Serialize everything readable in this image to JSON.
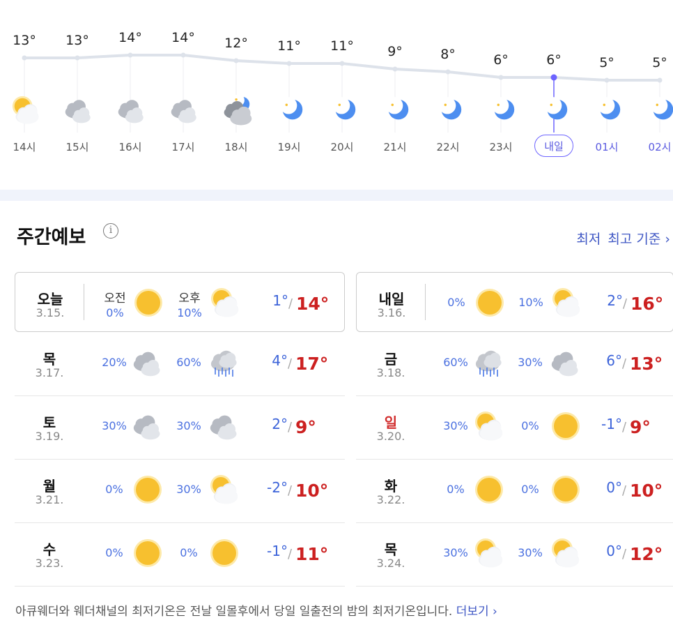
{
  "hourly": [
    {
      "temp": "13°",
      "time": "14시",
      "icon": "partly-cloudy-sun",
      "value": 13
    },
    {
      "temp": "13°",
      "time": "15시",
      "icon": "cloudy",
      "value": 13
    },
    {
      "temp": "14°",
      "time": "16시",
      "icon": "cloudy",
      "value": 14
    },
    {
      "temp": "14°",
      "time": "17시",
      "icon": "cloudy",
      "value": 14
    },
    {
      "temp": "12°",
      "time": "18시",
      "icon": "cloudy-night",
      "value": 12
    },
    {
      "temp": "11°",
      "time": "19시",
      "icon": "clear-night",
      "value": 11
    },
    {
      "temp": "11°",
      "time": "20시",
      "icon": "clear-night",
      "value": 11
    },
    {
      "temp": "9°",
      "time": "21시",
      "icon": "clear-night",
      "value": 9
    },
    {
      "temp": "8°",
      "time": "22시",
      "icon": "clear-night",
      "value": 8
    },
    {
      "temp": "6°",
      "time": "23시",
      "icon": "clear-night",
      "value": 6
    },
    {
      "temp": "6°",
      "time": "내일",
      "icon": "clear-night",
      "value": 6,
      "current": true
    },
    {
      "temp": "5°",
      "time": "01시",
      "icon": "clear-night",
      "value": 5,
      "tomorrow": true
    },
    {
      "temp": "5°",
      "time": "02시",
      "icon": "clear-night",
      "value": 5,
      "tomorrow": true
    }
  ],
  "weekly": {
    "title": "주간예보",
    "criteria_low": "최저",
    "criteria_high": "최고 기준",
    "am_label": "오전",
    "pm_label": "오후",
    "days": [
      {
        "name": "오늘",
        "date": "3.15.",
        "am_pct": "0%",
        "am_icon": "sunny",
        "pm_pct": "10%",
        "pm_icon": "partly-cloudy",
        "lo": "1°",
        "hi": "14°",
        "today": true
      },
      {
        "name": "내일",
        "date": "3.16.",
        "am_pct": "0%",
        "am_icon": "sunny",
        "pm_pct": "10%",
        "pm_icon": "partly-cloudy",
        "lo": "2°",
        "hi": "16°",
        "today": true
      },
      {
        "name": "목",
        "date": "3.17.",
        "am_pct": "20%",
        "am_icon": "cloudy",
        "pm_pct": "60%",
        "pm_icon": "rain",
        "lo": "4°",
        "hi": "17°"
      },
      {
        "name": "금",
        "date": "3.18.",
        "am_pct": "60%",
        "am_icon": "rain",
        "pm_pct": "30%",
        "pm_icon": "cloudy",
        "lo": "6°",
        "hi": "13°"
      },
      {
        "name": "토",
        "date": "3.19.",
        "am_pct": "30%",
        "am_icon": "cloudy",
        "pm_pct": "30%",
        "pm_icon": "cloudy",
        "lo": "2°",
        "hi": "9°"
      },
      {
        "name": "일",
        "date": "3.20.",
        "am_pct": "30%",
        "am_icon": "partly-cloudy",
        "pm_pct": "0%",
        "pm_icon": "sunny",
        "lo": "-1°",
        "hi": "9°",
        "sunday": true
      },
      {
        "name": "월",
        "date": "3.21.",
        "am_pct": "0%",
        "am_icon": "sunny",
        "pm_pct": "30%",
        "pm_icon": "partly-cloudy",
        "lo": "-2°",
        "hi": "10°"
      },
      {
        "name": "화",
        "date": "3.22.",
        "am_pct": "0%",
        "am_icon": "sunny",
        "pm_pct": "0%",
        "pm_icon": "sunny",
        "lo": "0°",
        "hi": "10°"
      },
      {
        "name": "수",
        "date": "3.23.",
        "am_pct": "0%",
        "am_icon": "sunny",
        "pm_pct": "0%",
        "pm_icon": "sunny",
        "lo": "-1°",
        "hi": "11°"
      },
      {
        "name": "목",
        "date": "3.24.",
        "am_pct": "30%",
        "am_icon": "partly-cloudy",
        "pm_pct": "30%",
        "pm_icon": "partly-cloudy",
        "lo": "0°",
        "hi": "12°"
      }
    ]
  },
  "footer": {
    "text": "아큐웨더와 웨더채널의 최저기온은 전날 일몰후에서 당일 일출전의 밤의 최저기온입니다.",
    "more": "더보기"
  },
  "colors": {
    "accent": "#6c63ff",
    "low": "#3c63d9",
    "high": "#cc2020",
    "sunday": "#d12c2c"
  }
}
